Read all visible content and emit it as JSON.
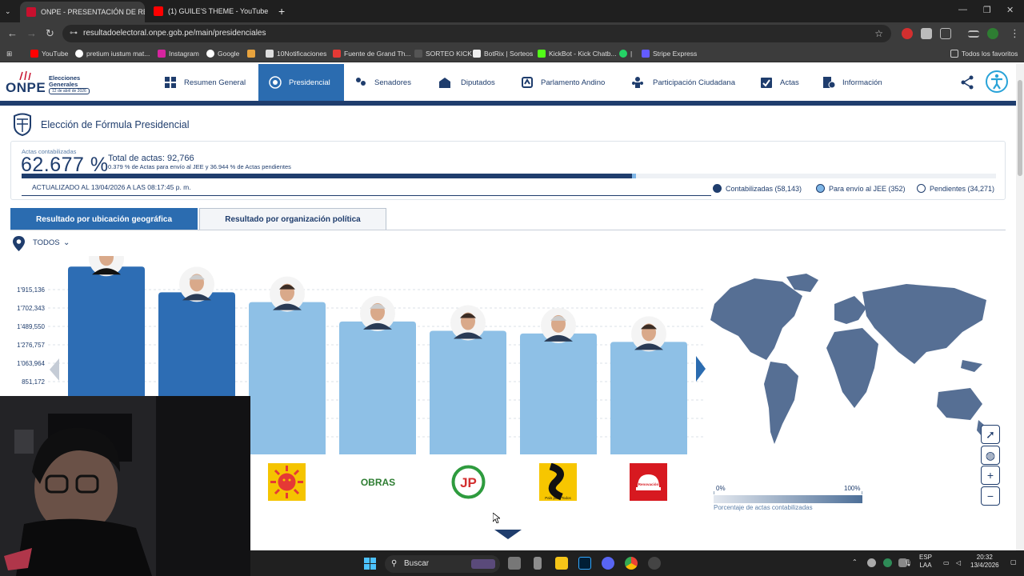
{
  "browser": {
    "tabs": [
      {
        "title": "ONPE - PRESENTACIÓN DE RE",
        "active": true
      },
      {
        "title": "(1) GUILE'S THEME - YouTube",
        "active": false
      }
    ],
    "url": "resultadoelectoral.onpe.gob.pe/main/presidenciales",
    "bookmarks": [
      "YouTube",
      "pretium iustum mat...",
      "Instagram",
      "Google",
      "10Notificaciones",
      "Fuente de Grand Th...",
      "SORTEO KICK",
      "BotRix | Sorteos",
      "KickBot - Kick Chatb...",
      "|",
      "Stripe Express"
    ],
    "all_bookmarks": "Todos los favoritos"
  },
  "site": {
    "logo": {
      "brand": "ONPE",
      "line1": "Elecciones",
      "line2": "Generales",
      "date": "12 de abril de 2026"
    },
    "nav": [
      "Resumen General",
      "Presidencial",
      "Senadores",
      "Diputados",
      "Parlamento Andino",
      "Participación Ciudadana",
      "Actas",
      "Información"
    ],
    "active_nav": "Presidencial"
  },
  "page": {
    "title": "Elección de Fórmula Presidencial",
    "actas_label": "Actas contabilizadas",
    "percent": "62.677 %",
    "total": "Total de actas: 92,766",
    "sub": "0.379 % de Actas para envío al JEE y 36.944 % de Actas pendientes",
    "progress": {
      "contabilizadas": 0.62677,
      "jee": 0.00379
    },
    "updated": "ACTUALIZADO AL 13/04/2026 A LAS 08:17:45 p. m.",
    "legend": [
      {
        "label": "Contabilizadas (58,143)",
        "color": "#1f3d6d"
      },
      {
        "label": "Para envío al JEE (352)",
        "color": "#7fb6e6"
      },
      {
        "label": "Pendientes (34,271)",
        "color": "#ffffff"
      }
    ],
    "tabs": [
      "Resultado por ubicación geográfica",
      "Resultado por organización política"
    ],
    "filter": "TODOS",
    "logo_texts": [
      "OBRAS",
      "JP",
      "País para Todos",
      "Renovación"
    ],
    "map_scale": {
      "min": "0%",
      "max": "100%",
      "caption": "Porcentaje de actas contabilizadas"
    }
  },
  "chart_data": {
    "type": "bar",
    "ytick_labels": [
      "1'915,136",
      "1'702,343",
      "1'489,550",
      "1'276,757",
      "1'063,964",
      "851,172"
    ],
    "values": [
      2120000,
      1830000,
      1720000,
      1500000,
      1395000,
      1365000,
      1270000
    ],
    "highlight": [
      true,
      true,
      false,
      false,
      false,
      false,
      false
    ],
    "colors": {
      "highlight": "#2d6db4",
      "normal": "#8ec0e6"
    }
  },
  "taskbar": {
    "search": "Buscar",
    "lang": [
      "ESP",
      "LAA"
    ],
    "time": "20:32",
    "date": "13/4/2026"
  }
}
